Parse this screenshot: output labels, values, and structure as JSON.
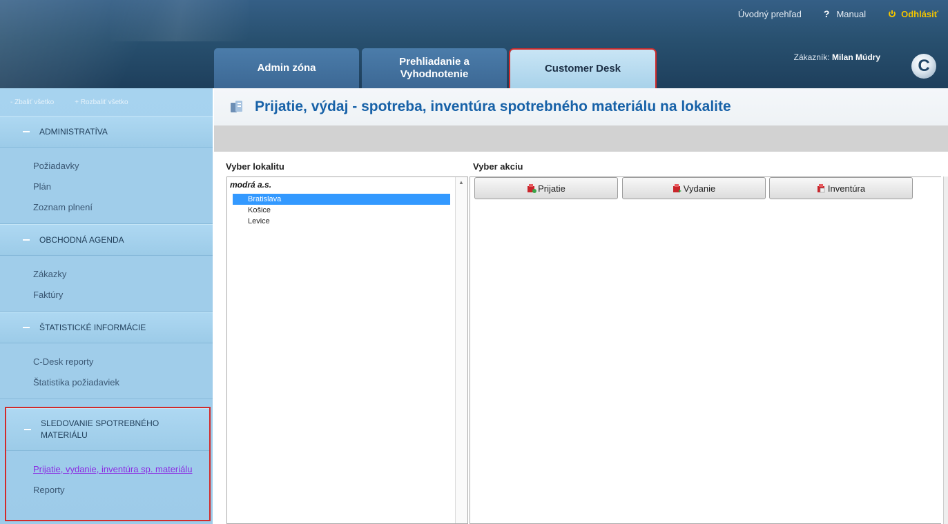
{
  "header": {
    "links": {
      "overview": "Úvodný prehľad",
      "manual": "Manual",
      "logout": "Odhlásiť"
    },
    "tabs": {
      "admin": "Admin zóna",
      "prehliadanie_line1": "Prehliadanie a",
      "prehliadanie_line2": "Vyhodnotenie",
      "customer": "Customer Desk"
    },
    "customer_prefix": "Zákazník:",
    "customer_name": "Milan Múdry",
    "logo_letter": "C"
  },
  "sidebar": {
    "collapse_all": "- Zbaliť všetko",
    "expand_all": "+ Rozbaliť všetko",
    "groups": [
      {
        "title": "ADMINISTRATÍVA",
        "items": [
          "Požiadavky",
          "Plán",
          "Zoznam plnení"
        ]
      },
      {
        "title": "OBCHODNÁ AGENDA",
        "items": [
          "Zákazky",
          "Faktúry"
        ]
      },
      {
        "title": "ŠTATISTICKÉ INFORMÁCIE",
        "items": [
          "C-Desk reporty",
          "Štatistika požiadaviek"
        ]
      },
      {
        "title_line1": "SLEDOVANIE SPOTREBNÉHO",
        "title_line2": "MATERIÁLU",
        "items": [
          "Prijatie, vydanie, inventúra sp. materiálu",
          "Reporty"
        ]
      }
    ]
  },
  "main": {
    "title": "Prijatie, výdaj - spotreba, inventúra spotrebného materiálu na lokalite",
    "label_lokalita": "Vyber lokalitu",
    "label_akcia": "Vyber akciu",
    "tree": {
      "org": "modrá a.s.",
      "nodes": [
        "Bratislava",
        "Košice",
        "Levice"
      ],
      "selected": "Bratislava"
    },
    "actions": [
      "Prijatie",
      "Vydanie",
      "Inventúra"
    ]
  },
  "colors": {
    "header_bg": "#28506f",
    "sidebar_bg": "#a7d3ef",
    "title_blue": "#1862a8",
    "highlight_red": "#d12b2b",
    "logout_yellow": "#f2c400",
    "selection_blue": "#3399ff"
  }
}
